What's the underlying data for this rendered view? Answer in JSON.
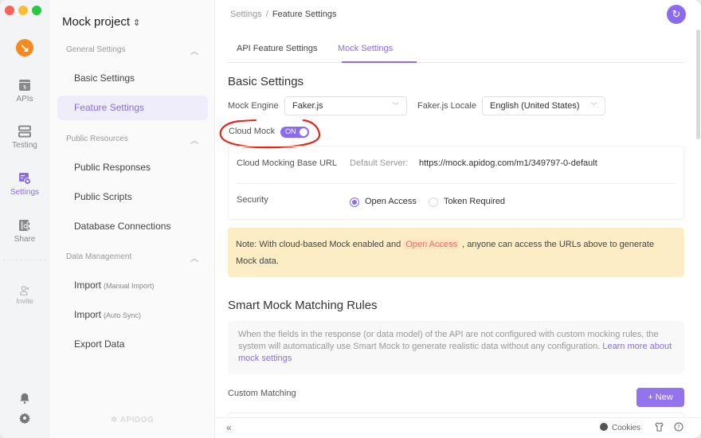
{
  "rail": {
    "items": [
      {
        "label": "APIs",
        "icon": "apis-icon"
      },
      {
        "label": "Testing",
        "icon": "testing-icon"
      },
      {
        "label": "Settings",
        "icon": "settings-icon",
        "active": true
      },
      {
        "label": "Share",
        "icon": "share-icon"
      },
      {
        "label": "Invite",
        "icon": "invite-icon"
      }
    ],
    "bottom_icons": [
      "bell-icon",
      "gear-icon"
    ]
  },
  "sidebar": {
    "project_name": "Mock project",
    "project_switch_glyph": "⌃⌄",
    "groups": [
      {
        "title": "General Settings",
        "items": [
          {
            "label": "Basic Settings"
          },
          {
            "label": "Feature Settings",
            "active": true
          }
        ]
      },
      {
        "title": "Public Resources",
        "items": [
          {
            "label": "Public Responses"
          },
          {
            "label": "Public Scripts"
          },
          {
            "label": "Database Connections"
          }
        ]
      },
      {
        "title": "Data Management",
        "items": [
          {
            "label": "Import",
            "sub": "(Manual Import)"
          },
          {
            "label": "Import",
            "sub": "(Auto Sync)"
          },
          {
            "label": "Export Data"
          }
        ]
      }
    ],
    "watermark": "APIDOG"
  },
  "header": {
    "breadcrumb": [
      "Settings",
      "Feature Settings"
    ],
    "breadcrumb_sep": "/"
  },
  "tabs": [
    {
      "label": "API Feature Settings"
    },
    {
      "label": "Mock Settings",
      "active": true
    }
  ],
  "basic_settings": {
    "title": "Basic Settings",
    "mock_engine_label": "Mock Engine",
    "mock_engine_value": "Faker.js",
    "locale_label": "Faker.js Locale",
    "locale_value": "English (United States)",
    "cloud_mock_label": "Cloud Mock",
    "cloud_mock_state": "ON",
    "cloud_mock_enabled": true,
    "base_url_label": "Cloud Mocking Base URL",
    "default_server_label": "Default Server:",
    "base_url_value": "https://mock.apidog.com/m1/349797-0-default",
    "security_label": "Security",
    "security_options": [
      {
        "label": "Open Access",
        "checked": true
      },
      {
        "label": "Token Required",
        "checked": false
      }
    ]
  },
  "note": {
    "prefix": "Note: With cloud-based Mock enabled and",
    "highlight": "Open Access",
    "suffix": ", anyone can access the URLs above to generate Mock data."
  },
  "smart_mock": {
    "title": "Smart Mock Matching Rules",
    "description": "When the fields in the response (or data model) of the API are not configured with custom mocking rules, the system will automatically use Smart Mock to generate realistic data without any configuration.",
    "link": "Learn more about mock settings"
  },
  "custom_matching": {
    "label": "Custom Matching",
    "new_button": "+ New"
  },
  "footer": {
    "collapse_glyph": "«",
    "cookies": "Cookies"
  },
  "colors": {
    "accent": "#8b6cf0",
    "brand_logo": "#f58a1f",
    "note_bg": "#fdedc4",
    "note_highlight": "#f36b6b",
    "annotation_stroke": "#e0291c"
  }
}
